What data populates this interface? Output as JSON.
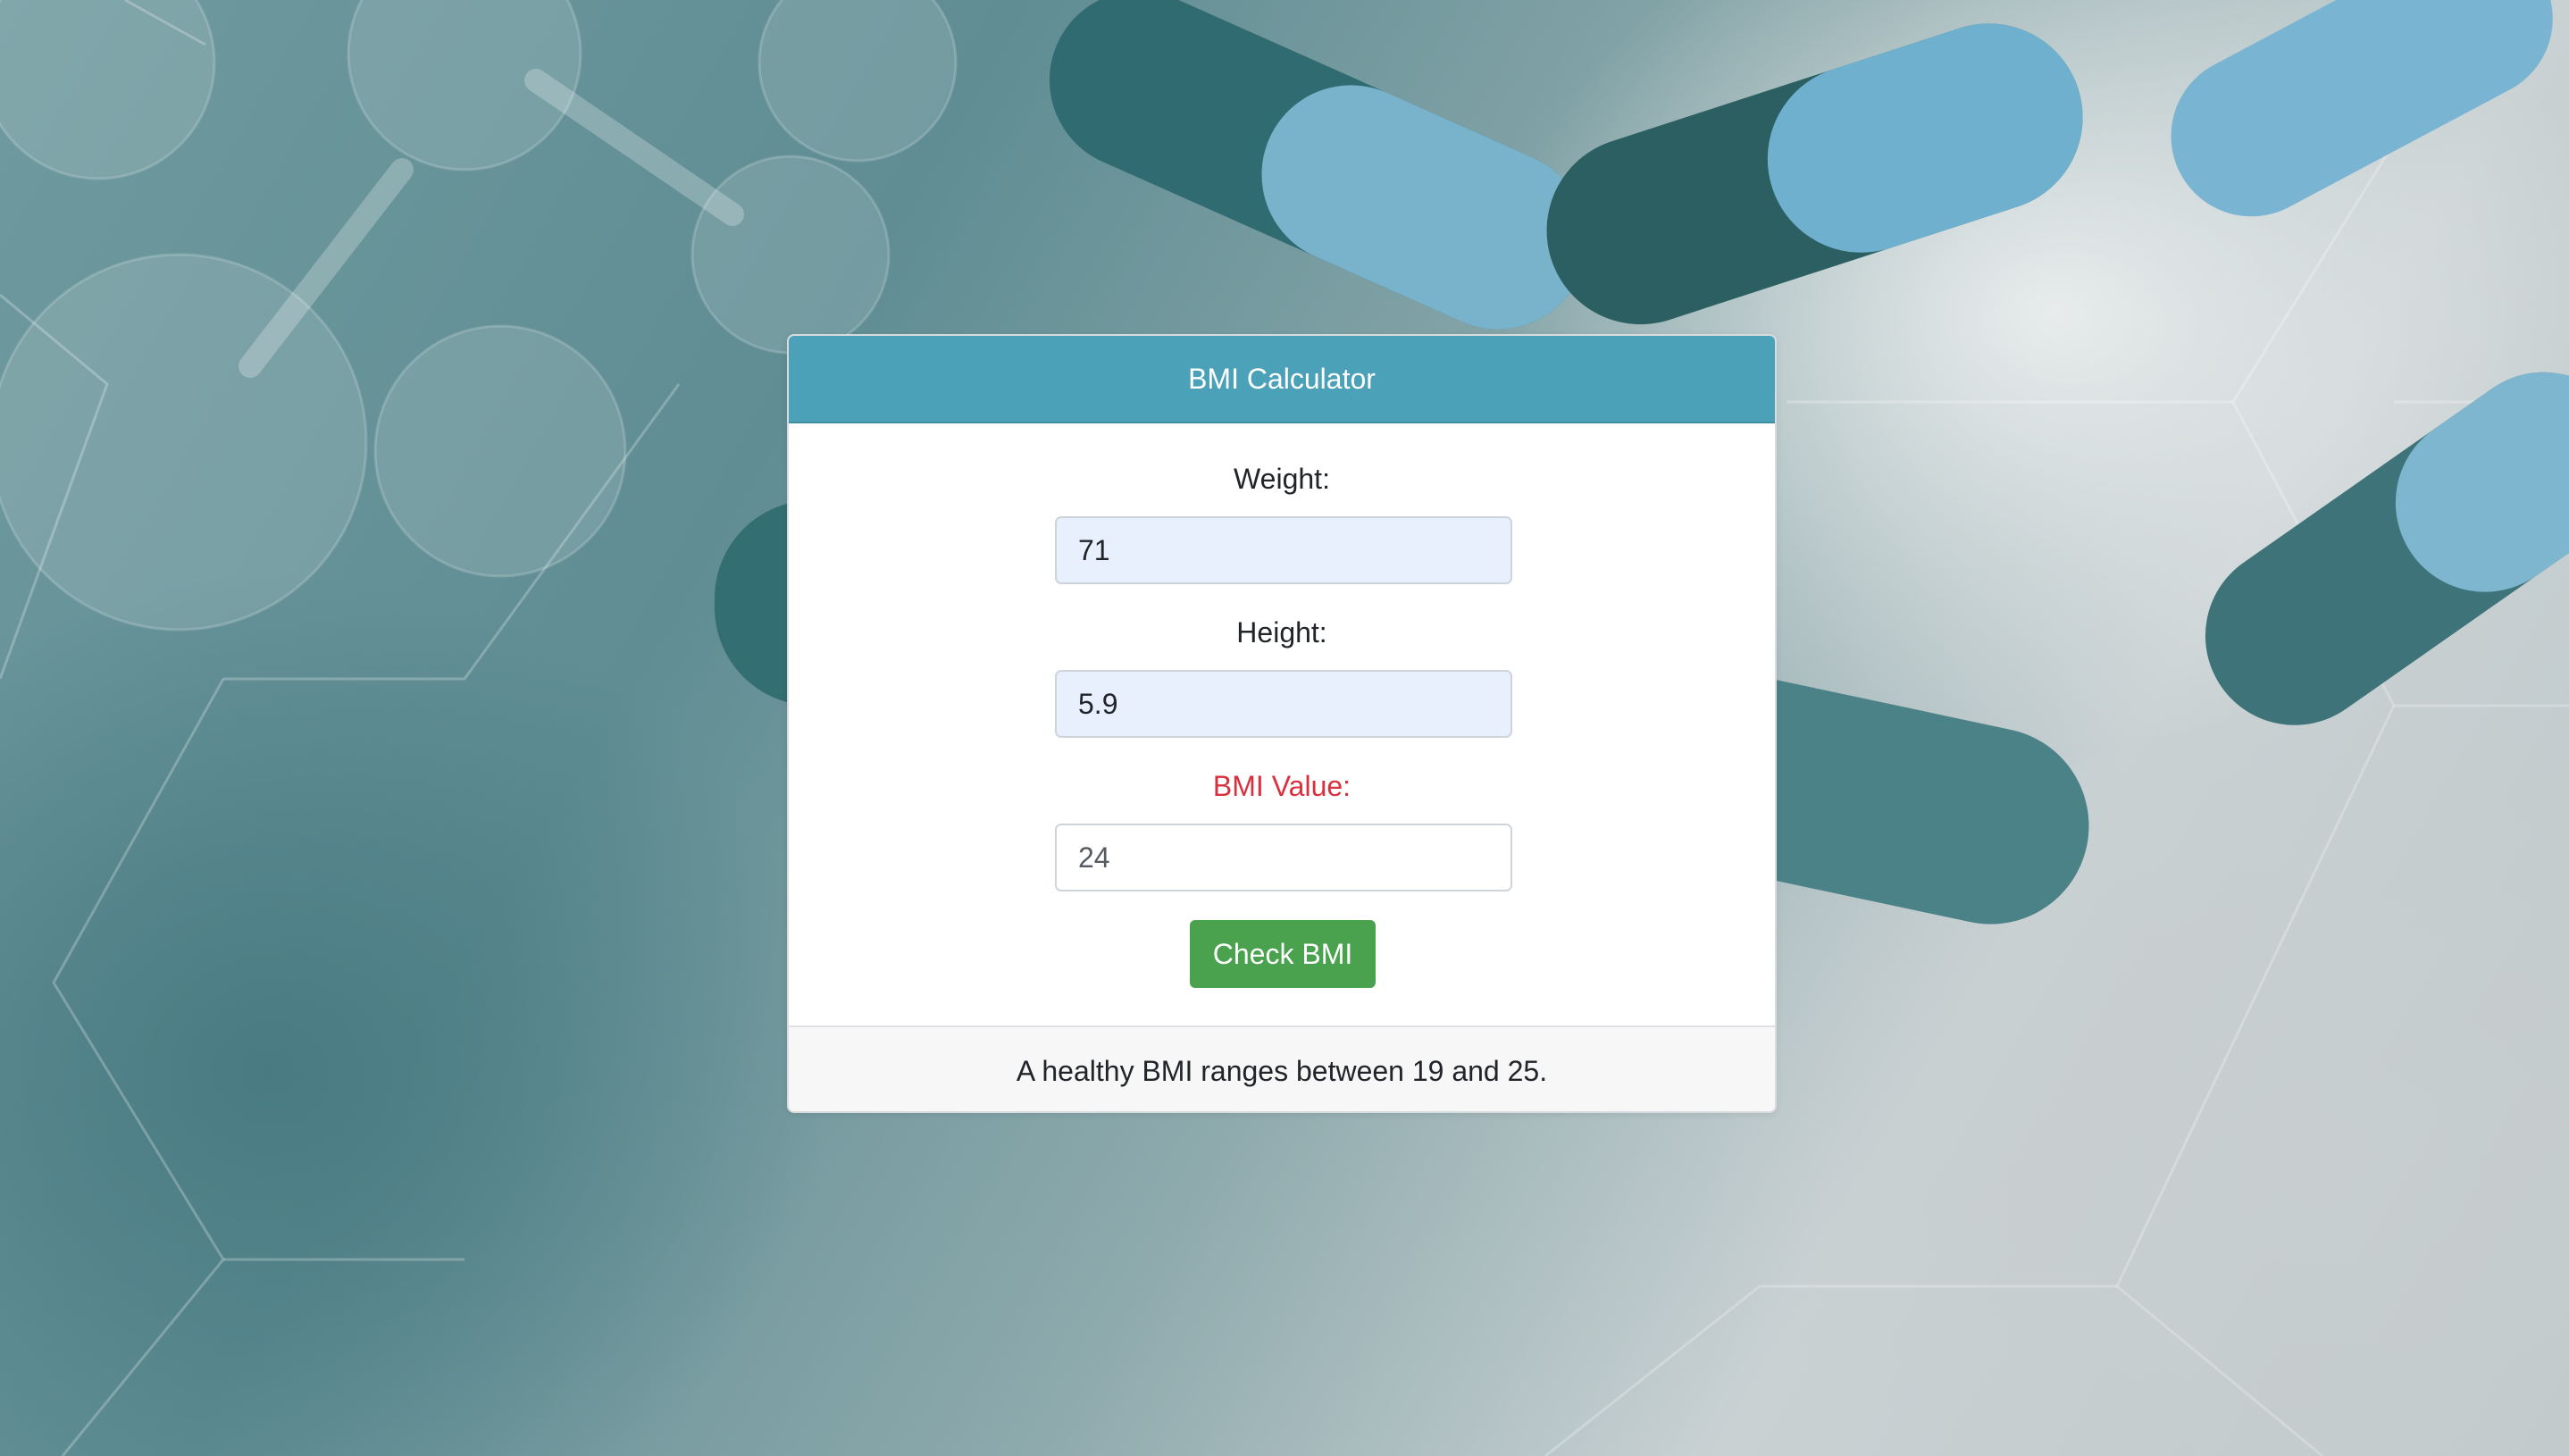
{
  "card": {
    "title": "BMI Calculator",
    "weight_label": "Weight:",
    "weight_value": "71",
    "height_label": "Height:",
    "height_value": "5.9",
    "bmi_label": "BMI Value:",
    "bmi_value": "24",
    "check_button": "Check BMI",
    "footer_text": "A healthy BMI ranges between 19 and 25."
  },
  "colors": {
    "header": "#4aa1b8",
    "button": "#4aa24f",
    "bmi_label": "#d9303d",
    "filled_input": "#e8effd"
  }
}
